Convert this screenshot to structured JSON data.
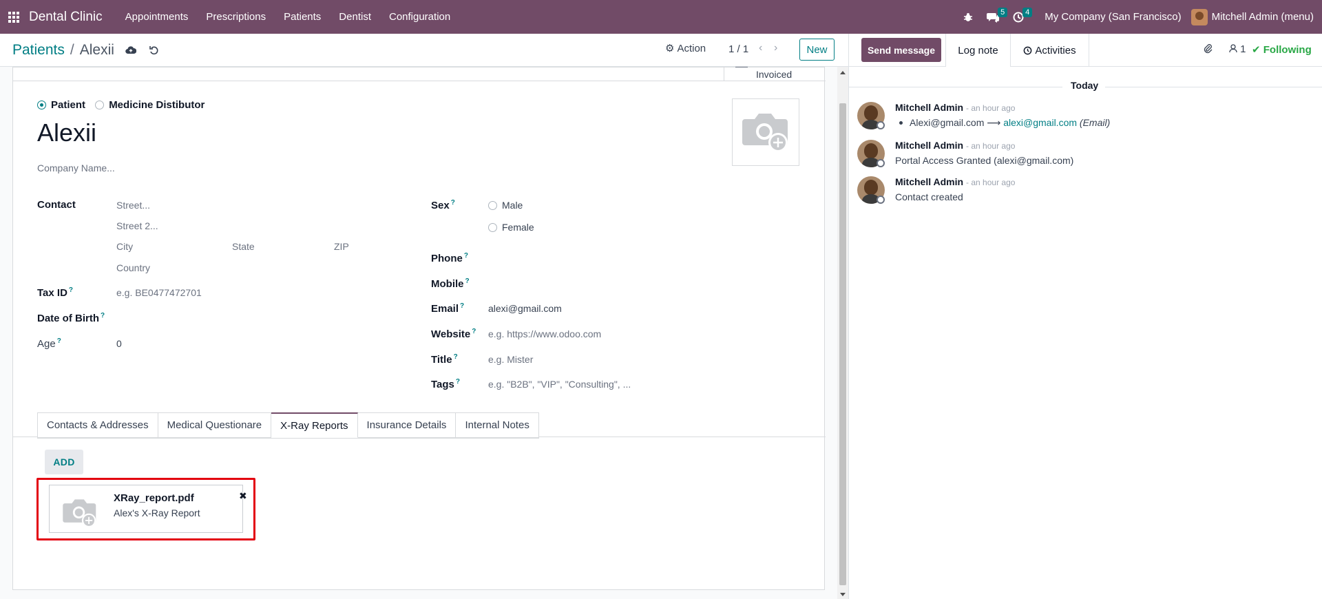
{
  "navbar": {
    "brand": "Dental Clinic",
    "menu": [
      "Appointments",
      "Prescriptions",
      "Patients",
      "Dentist",
      "Configuration"
    ],
    "messages_count": "5",
    "activities_count": "4",
    "company": "My Company (San Francisco)",
    "user": "Mitchell Admin (menu)"
  },
  "control_panel": {
    "breadcrumb_parent": "Patients",
    "breadcrumb_sep": "/",
    "breadcrumb_current": "Alexii",
    "action_label": "Action",
    "pager": "1 / 1",
    "new_label": "New"
  },
  "smart_buttons": {
    "invoiced_label": "Invoiced"
  },
  "form": {
    "type_options": [
      {
        "label": "Patient",
        "selected": true
      },
      {
        "label": "Medicine Distibutor",
        "selected": false
      }
    ],
    "name": "Alexii",
    "company_placeholder": "Company Name...",
    "contact_label": "Contact",
    "street_placeholder": "Street...",
    "street2_placeholder": "Street 2...",
    "city_placeholder": "City",
    "state_placeholder": "State",
    "zip_placeholder": "ZIP",
    "country_placeholder": "Country",
    "tax_id_label": "Tax ID",
    "tax_id_placeholder": "e.g. BE0477472701",
    "dob_label": "Date of Birth",
    "age_label": "Age",
    "age_value": "0",
    "sex_label": "Sex",
    "sex_options": [
      {
        "label": "Male",
        "selected": false
      },
      {
        "label": "Female",
        "selected": false
      }
    ],
    "phone_label": "Phone",
    "mobile_label": "Mobile",
    "email_label": "Email",
    "email_value": "alexi@gmail.com",
    "website_label": "Website",
    "website_placeholder": "e.g. https://www.odoo.com",
    "title_label": "Title",
    "title_placeholder": "e.g. Mister",
    "tags_label": "Tags",
    "tags_placeholder": "e.g. \"B2B\", \"VIP\", \"Consulting\", ...",
    "help_mark": "?"
  },
  "tabs": [
    {
      "label": "Contacts & Addresses",
      "active": false
    },
    {
      "label": "Medical Questionare",
      "active": false
    },
    {
      "label": "X-Ray Reports",
      "active": true
    },
    {
      "label": "Insurance Details",
      "active": false
    },
    {
      "label": "Internal Notes",
      "active": false
    }
  ],
  "xray": {
    "add_label": "ADD",
    "file_name": "XRay_report.pdf",
    "file_desc": "Alex's X-Ray Report",
    "remove_glyph": "✖"
  },
  "chatter": {
    "send_message": "Send message",
    "log_note": "Log note",
    "activities": "Activities",
    "followers_count": "1",
    "following": "Following",
    "date_separator": "Today",
    "messages": [
      {
        "author": "Mitchell Admin",
        "time": "- an hour ago",
        "old_value": "Alexi@gmail.com",
        "arrow": "⟶",
        "new_value": "alexi@gmail.com",
        "field": "(Email)"
      },
      {
        "author": "Mitchell Admin",
        "time": "- an hour ago",
        "text": "Portal Access Granted (alexi@gmail.com)"
      },
      {
        "author": "Mitchell Admin",
        "time": "- an hour ago",
        "text": "Contact created"
      }
    ]
  },
  "colors": {
    "brand": "#714b67",
    "accent": "#017e84",
    "highlight": "#e3000f",
    "following": "#28a745"
  }
}
